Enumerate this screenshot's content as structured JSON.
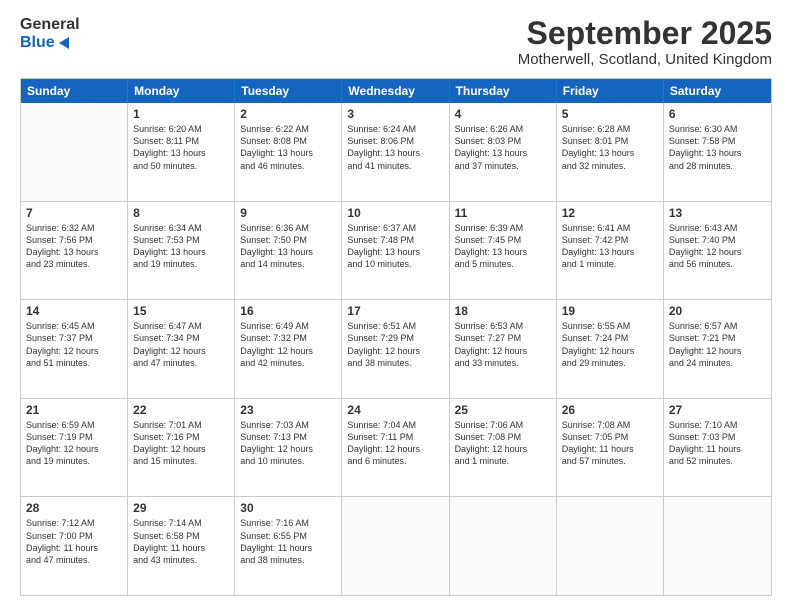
{
  "header": {
    "logo_general": "General",
    "logo_blue": "Blue",
    "month_title": "September 2025",
    "location": "Motherwell, Scotland, United Kingdom"
  },
  "days_of_week": [
    "Sunday",
    "Monday",
    "Tuesday",
    "Wednesday",
    "Thursday",
    "Friday",
    "Saturday"
  ],
  "weeks": [
    [
      {
        "day": "",
        "lines": []
      },
      {
        "day": "1",
        "lines": [
          "Sunrise: 6:20 AM",
          "Sunset: 8:11 PM",
          "Daylight: 13 hours",
          "and 50 minutes."
        ]
      },
      {
        "day": "2",
        "lines": [
          "Sunrise: 6:22 AM",
          "Sunset: 8:08 PM",
          "Daylight: 13 hours",
          "and 46 minutes."
        ]
      },
      {
        "day": "3",
        "lines": [
          "Sunrise: 6:24 AM",
          "Sunset: 8:06 PM",
          "Daylight: 13 hours",
          "and 41 minutes."
        ]
      },
      {
        "day": "4",
        "lines": [
          "Sunrise: 6:26 AM",
          "Sunset: 8:03 PM",
          "Daylight: 13 hours",
          "and 37 minutes."
        ]
      },
      {
        "day": "5",
        "lines": [
          "Sunrise: 6:28 AM",
          "Sunset: 8:01 PM",
          "Daylight: 13 hours",
          "and 32 minutes."
        ]
      },
      {
        "day": "6",
        "lines": [
          "Sunrise: 6:30 AM",
          "Sunset: 7:58 PM",
          "Daylight: 13 hours",
          "and 28 minutes."
        ]
      }
    ],
    [
      {
        "day": "7",
        "lines": [
          "Sunrise: 6:32 AM",
          "Sunset: 7:56 PM",
          "Daylight: 13 hours",
          "and 23 minutes."
        ]
      },
      {
        "day": "8",
        "lines": [
          "Sunrise: 6:34 AM",
          "Sunset: 7:53 PM",
          "Daylight: 13 hours",
          "and 19 minutes."
        ]
      },
      {
        "day": "9",
        "lines": [
          "Sunrise: 6:36 AM",
          "Sunset: 7:50 PM",
          "Daylight: 13 hours",
          "and 14 minutes."
        ]
      },
      {
        "day": "10",
        "lines": [
          "Sunrise: 6:37 AM",
          "Sunset: 7:48 PM",
          "Daylight: 13 hours",
          "and 10 minutes."
        ]
      },
      {
        "day": "11",
        "lines": [
          "Sunrise: 6:39 AM",
          "Sunset: 7:45 PM",
          "Daylight: 13 hours",
          "and 5 minutes."
        ]
      },
      {
        "day": "12",
        "lines": [
          "Sunrise: 6:41 AM",
          "Sunset: 7:42 PM",
          "Daylight: 13 hours",
          "and 1 minute."
        ]
      },
      {
        "day": "13",
        "lines": [
          "Sunrise: 6:43 AM",
          "Sunset: 7:40 PM",
          "Daylight: 12 hours",
          "and 56 minutes."
        ]
      }
    ],
    [
      {
        "day": "14",
        "lines": [
          "Sunrise: 6:45 AM",
          "Sunset: 7:37 PM",
          "Daylight: 12 hours",
          "and 51 minutes."
        ]
      },
      {
        "day": "15",
        "lines": [
          "Sunrise: 6:47 AM",
          "Sunset: 7:34 PM",
          "Daylight: 12 hours",
          "and 47 minutes."
        ]
      },
      {
        "day": "16",
        "lines": [
          "Sunrise: 6:49 AM",
          "Sunset: 7:32 PM",
          "Daylight: 12 hours",
          "and 42 minutes."
        ]
      },
      {
        "day": "17",
        "lines": [
          "Sunrise: 6:51 AM",
          "Sunset: 7:29 PM",
          "Daylight: 12 hours",
          "and 38 minutes."
        ]
      },
      {
        "day": "18",
        "lines": [
          "Sunrise: 6:53 AM",
          "Sunset: 7:27 PM",
          "Daylight: 12 hours",
          "and 33 minutes."
        ]
      },
      {
        "day": "19",
        "lines": [
          "Sunrise: 6:55 AM",
          "Sunset: 7:24 PM",
          "Daylight: 12 hours",
          "and 29 minutes."
        ]
      },
      {
        "day": "20",
        "lines": [
          "Sunrise: 6:57 AM",
          "Sunset: 7:21 PM",
          "Daylight: 12 hours",
          "and 24 minutes."
        ]
      }
    ],
    [
      {
        "day": "21",
        "lines": [
          "Sunrise: 6:59 AM",
          "Sunset: 7:19 PM",
          "Daylight: 12 hours",
          "and 19 minutes."
        ]
      },
      {
        "day": "22",
        "lines": [
          "Sunrise: 7:01 AM",
          "Sunset: 7:16 PM",
          "Daylight: 12 hours",
          "and 15 minutes."
        ]
      },
      {
        "day": "23",
        "lines": [
          "Sunrise: 7:03 AM",
          "Sunset: 7:13 PM",
          "Daylight: 12 hours",
          "and 10 minutes."
        ]
      },
      {
        "day": "24",
        "lines": [
          "Sunrise: 7:04 AM",
          "Sunset: 7:11 PM",
          "Daylight: 12 hours",
          "and 6 minutes."
        ]
      },
      {
        "day": "25",
        "lines": [
          "Sunrise: 7:06 AM",
          "Sunset: 7:08 PM",
          "Daylight: 12 hours",
          "and 1 minute."
        ]
      },
      {
        "day": "26",
        "lines": [
          "Sunrise: 7:08 AM",
          "Sunset: 7:05 PM",
          "Daylight: 11 hours",
          "and 57 minutes."
        ]
      },
      {
        "day": "27",
        "lines": [
          "Sunrise: 7:10 AM",
          "Sunset: 7:03 PM",
          "Daylight: 11 hours",
          "and 52 minutes."
        ]
      }
    ],
    [
      {
        "day": "28",
        "lines": [
          "Sunrise: 7:12 AM",
          "Sunset: 7:00 PM",
          "Daylight: 11 hours",
          "and 47 minutes."
        ]
      },
      {
        "day": "29",
        "lines": [
          "Sunrise: 7:14 AM",
          "Sunset: 6:58 PM",
          "Daylight: 11 hours",
          "and 43 minutes."
        ]
      },
      {
        "day": "30",
        "lines": [
          "Sunrise: 7:16 AM",
          "Sunset: 6:55 PM",
          "Daylight: 11 hours",
          "and 38 minutes."
        ]
      },
      {
        "day": "",
        "lines": []
      },
      {
        "day": "",
        "lines": []
      },
      {
        "day": "",
        "lines": []
      },
      {
        "day": "",
        "lines": []
      }
    ]
  ]
}
